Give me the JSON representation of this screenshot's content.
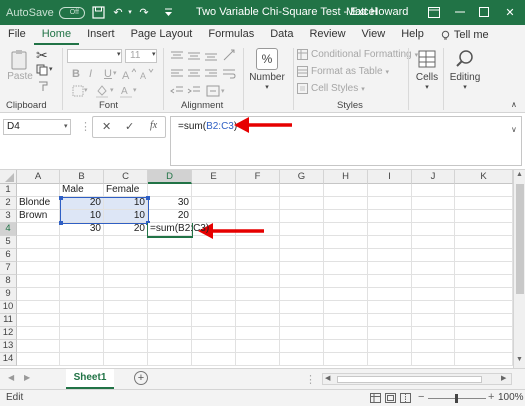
{
  "titlebar": {
    "autosave_label": "AutoSave",
    "autosave_state": "Off",
    "doc_title": "Two Variable Chi-Square Test - Excel",
    "user": "Matt Howard"
  },
  "tabs": [
    "File",
    "Home",
    "Insert",
    "Page Layout",
    "Formulas",
    "Data",
    "Review",
    "View",
    "Help",
    "Tell me"
  ],
  "active_tab": "Home",
  "ribbon": {
    "paste_label": "Paste",
    "font_size": "11",
    "bold": "B",
    "italic": "I",
    "underline": "U",
    "number_label": "Number",
    "number_symbol": "%",
    "conditional_formatting": "Conditional Formatting",
    "format_as_table": "Format as Table",
    "cell_styles": "Cell Styles",
    "cells_label": "Cells",
    "editing_label": "Editing",
    "groups": {
      "clipboard": "Clipboard",
      "font": "Font",
      "alignment": "Alignment",
      "styles": "Styles"
    }
  },
  "formula_bar": {
    "name_box": "D4",
    "cancel": "✕",
    "enter": "✓",
    "fx": "fx",
    "formula_prefix": "=sum(",
    "formula_ref": "B2:C3",
    "formula_suffix": ")"
  },
  "columns": [
    "A",
    "B",
    "C",
    "D",
    "E",
    "F",
    "G",
    "H",
    "I",
    "J",
    "K"
  ],
  "rows": [
    "1",
    "2",
    "3",
    "4",
    "5",
    "6",
    "7",
    "8",
    "9",
    "10",
    "11",
    "12",
    "13",
    "14"
  ],
  "cells": {
    "B1": "Male",
    "C1": "Female",
    "A2": "Blonde",
    "B2": "20",
    "C2": "10",
    "D2": "30",
    "A3": "Brown",
    "B3": "10",
    "C3": "10",
    "D3": "20",
    "B4": "30",
    "C4": "20",
    "D4": "=sum(B2:C3)"
  },
  "sheet_tab": "Sheet1",
  "status": {
    "mode": "Edit",
    "zoom": "100%"
  },
  "colors": {
    "excel_green": "#217346",
    "arrow_red": "#e60000",
    "ref_blue": "#2f5fc4"
  }
}
